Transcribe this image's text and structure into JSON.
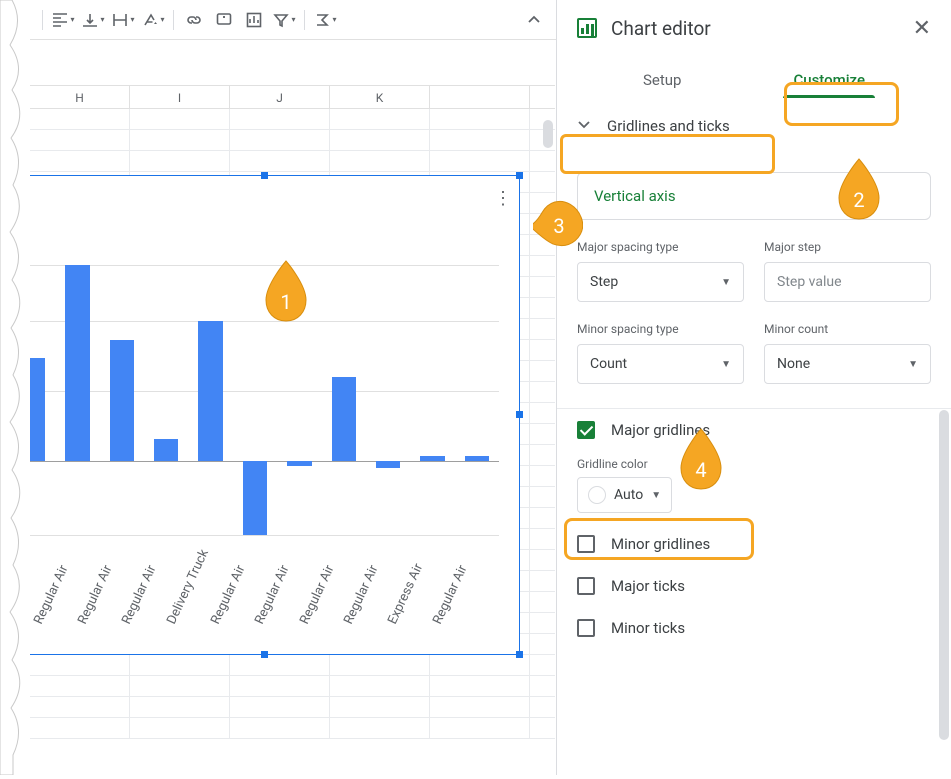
{
  "toolbar": {
    "collapse": "^"
  },
  "columns": [
    "H",
    "I",
    "J",
    "K"
  ],
  "chart_data": {
    "type": "bar",
    "categories": [
      "Regular Air",
      "Regular Air",
      "Regular Air",
      "Regular Air",
      "Delivery Truck",
      "Regular Air",
      "Regular Air",
      "Regular Air",
      "Regular Air",
      "Express Air",
      "Regular Air"
    ],
    "values": [
      110,
      210,
      130,
      24,
      150,
      -80,
      -5,
      90,
      -8,
      5,
      5
    ],
    "ylim": [
      -100,
      220
    ],
    "gridlines": [
      -80,
      0,
      75,
      150,
      210
    ]
  },
  "editor": {
    "title": "Chart editor",
    "tab_setup": "Setup",
    "tab_customize": "Customize",
    "section": "Gridlines and ticks",
    "axis_label": "Vertical axis",
    "major_spacing_label": "Major spacing type",
    "major_spacing_value": "Step",
    "major_step_label": "Major step",
    "major_step_placeholder": "Step value",
    "minor_spacing_label": "Minor spacing type",
    "minor_spacing_value": "Count",
    "minor_count_label": "Minor count",
    "minor_count_value": "None",
    "major_gridlines": "Major gridlines",
    "gridline_color_label": "Gridline color",
    "gridline_color_value": "Auto",
    "minor_gridlines": "Minor gridlines",
    "major_ticks": "Major ticks",
    "minor_ticks": "Minor ticks"
  },
  "markers": {
    "m1": "1",
    "m2": "2",
    "m3": "3",
    "m4": "4"
  }
}
